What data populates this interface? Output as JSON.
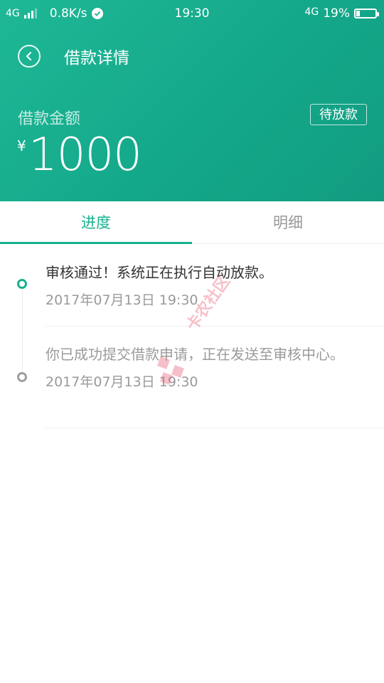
{
  "status_bar": {
    "network_left": "4G",
    "speed": "0.8K/s",
    "time": "19:30",
    "network_right": "4G",
    "battery": "19%"
  },
  "header": {
    "title": "借款详情",
    "amount_label": "借款金额",
    "status_badge": "待放款",
    "currency": "¥",
    "amount": "1000"
  },
  "tabs": [
    {
      "label": "进度",
      "active": true
    },
    {
      "label": "明细",
      "active": false
    }
  ],
  "timeline": [
    {
      "text": "审核通过！系统正在执行自动放款。",
      "time": "2017年07月13日 19:30",
      "active": true
    },
    {
      "text": "你已成功提交借款申请，正在发送至审核中心。",
      "time": "2017年07月13日 19:30",
      "active": false
    }
  ],
  "watermark": {
    "text": "卡农社区"
  },
  "colors": {
    "accent": "#17b18e",
    "header_start": "#1eb896",
    "header_end": "#119c80",
    "inactive": "#9e9e9e"
  },
  "icons": {
    "back": "chevron-left-icon",
    "verified": "check-circle-icon",
    "battery": "battery-icon",
    "signal": "signal-icon"
  }
}
